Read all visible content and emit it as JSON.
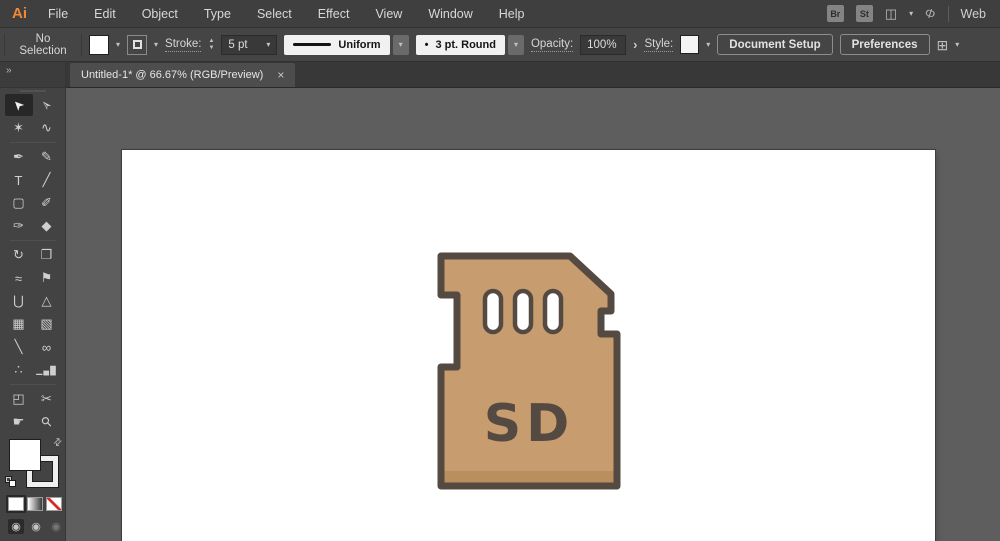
{
  "menu_bar": {
    "logo": "Ai",
    "items": [
      "File",
      "Edit",
      "Object",
      "Type",
      "Select",
      "Effect",
      "View",
      "Window",
      "Help"
    ],
    "bridge": "Br",
    "stock": "St",
    "workspace_icon": "◫",
    "chevron": "▾",
    "share_icon": "Φ",
    "workspace_name": "Web"
  },
  "control_bar": {
    "selection_status": "No Selection",
    "chevron": "▾",
    "stroke_label": "Stroke:",
    "stepper_up": "▲",
    "stepper_down": "▼",
    "stroke_weight": "5 pt",
    "profile_name": "Uniform",
    "brush_bullet": "•",
    "brush_name": "3 pt. Round",
    "opacity_label": "Opacity:",
    "opacity_value": "100%",
    "opacity_arrow": "›",
    "style_label": "Style:",
    "document_setup": "Document Setup",
    "preferences": "Preferences",
    "align_icon": "⊞"
  },
  "tools_panel": {
    "collapse_icon": "»",
    "swap_icon": "⇄",
    "draw_mode_icon": "◉",
    "tools": [
      {
        "name": "Selection Tool",
        "glyph": "➤"
      },
      {
        "name": "Direct Selection Tool",
        "glyph": "➢"
      },
      {
        "name": "Magic Wand Tool",
        "glyph": "✶"
      },
      {
        "name": "Lasso Tool",
        "glyph": "∿"
      },
      {
        "name": "Pen Tool",
        "glyph": "✒"
      },
      {
        "name": "Curvature Tool",
        "glyph": "✎"
      },
      {
        "name": "Type Tool",
        "glyph": "T"
      },
      {
        "name": "Line Segment Tool",
        "glyph": "╱"
      },
      {
        "name": "Rectangle Tool",
        "glyph": "▢"
      },
      {
        "name": "Paintbrush Tool",
        "glyph": "✐"
      },
      {
        "name": "Shaper Tool",
        "glyph": "✑"
      },
      {
        "name": "Eraser Tool",
        "glyph": "◆"
      },
      {
        "name": "Rotate Tool",
        "glyph": "↻"
      },
      {
        "name": "Scale Tool",
        "glyph": "❐"
      },
      {
        "name": "Width Tool",
        "glyph": "≈"
      },
      {
        "name": "Puppet Warp Tool",
        "glyph": "⚑"
      },
      {
        "name": "Shape Builder Tool",
        "glyph": "⋃"
      },
      {
        "name": "Perspective Grid Tool",
        "glyph": "△"
      },
      {
        "name": "Mesh Tool",
        "glyph": "▦"
      },
      {
        "name": "Gradient Tool",
        "glyph": "▧"
      },
      {
        "name": "Eyedropper Tool",
        "glyph": "╲"
      },
      {
        "name": "Blend Tool",
        "glyph": "∞"
      },
      {
        "name": "Symbol Sprayer Tool",
        "glyph": "∴"
      },
      {
        "name": "Column Graph Tool",
        "glyph": "▁▄█"
      },
      {
        "name": "Artboard Tool",
        "glyph": "◰"
      },
      {
        "name": "Slice Tool",
        "glyph": "✂"
      },
      {
        "name": "Hand Tool",
        "glyph": "☛"
      },
      {
        "name": "Zoom Tool",
        "glyph": "⚲"
      }
    ]
  },
  "document_tab": {
    "title": "Untitled-1* @ 66.67% (RGB/Preview)",
    "close_icon": "×"
  },
  "artboard": {
    "card": {
      "label": "SD",
      "fill": "#C79C6E",
      "shadow": "#B98F60",
      "outline": "#554A42",
      "slot_fill": "#FFFFFF"
    }
  },
  "colors": {
    "logo_orange": "#EE8A33",
    "pasteboard_gray": "#5E5E5E",
    "bar_gray": "#3F3F3F"
  }
}
